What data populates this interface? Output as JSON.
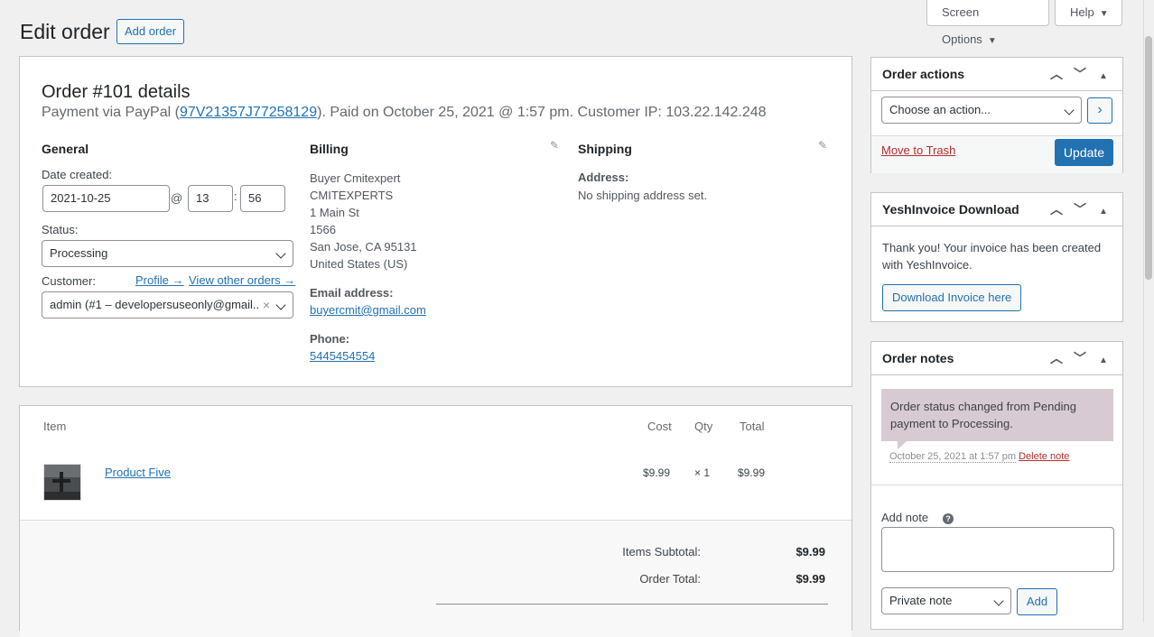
{
  "header": {
    "title": "Edit order",
    "add_order": "Add order",
    "screen_options": "Screen Options",
    "help": "Help"
  },
  "order": {
    "title": "Order #101 details",
    "sub_prefix": "Payment via PayPal (",
    "transaction_id": "97V21357J77258129",
    "sub_suffix": "). Paid on October 25, 2021 @ 1:57 pm. Customer IP: 103.22.142.248",
    "general": {
      "heading": "General",
      "date_label": "Date created:",
      "date": "2021-10-25",
      "at": "@",
      "hour": "13",
      "colon": ":",
      "minute": "56",
      "status_label": "Status:",
      "status": "Processing",
      "customer_label": "Customer:",
      "profile_link": "Profile →",
      "view_orders_link": "View other orders →",
      "customer": "admin (#1 – developersuseonly@gmail....",
      "clear": "×"
    },
    "billing": {
      "heading": "Billing",
      "lines": [
        "Buyer Cmitexpert",
        "CMITEXPERTS",
        "1 Main St",
        "1566",
        "San Jose, CA 95131",
        "United States (US)"
      ],
      "email_label": "Email address:",
      "email": "buyercmit@gmail.com",
      "phone_label": "Phone:",
      "phone": "5445454554"
    },
    "shipping": {
      "heading": "Shipping",
      "address_label": "Address:",
      "address": "No shipping address set."
    }
  },
  "items": {
    "headers": {
      "item": "Item",
      "cost": "Cost",
      "qty": "Qty",
      "total": "Total"
    },
    "rows": [
      {
        "name": "Product Five",
        "cost": "$9.99",
        "qty": "× 1",
        "total": "$9.99"
      }
    ],
    "subtotal_label": "Items Subtotal:",
    "subtotal": "$9.99",
    "order_total_label": "Order Total:",
    "order_total": "$9.99"
  },
  "order_actions": {
    "title": "Order actions",
    "select": "Choose an action...",
    "go": "›",
    "trash": "Move to Trash",
    "update": "Update"
  },
  "invoice": {
    "title": "YeshInvoice Download",
    "message": "Thank you! Your invoice has been created with YeshInvoice.",
    "download": "Download Invoice here"
  },
  "notes": {
    "title": "Order notes",
    "note_text": "Order status changed from Pending payment to Processing.",
    "note_date": "October 25, 2021 at 1:57 pm",
    "delete": "Delete note",
    "add_label": "Add note",
    "help": "?",
    "type": "Private note",
    "add_button": "Add"
  },
  "box_controls": {
    "up": "⌃",
    "down": "⌄",
    "toggle": "▲"
  }
}
